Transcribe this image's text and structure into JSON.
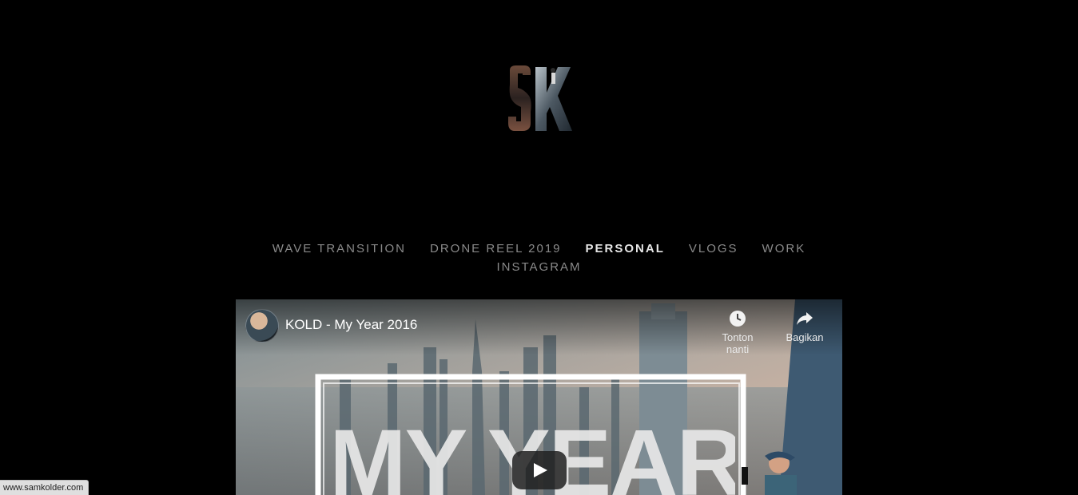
{
  "nav": {
    "row1": [
      "WAVE TRANSITION",
      "DRONE REEL 2019",
      "PERSONAL",
      "VLOGS",
      "WORK"
    ],
    "row2": [
      "INSTAGRAM"
    ],
    "active": "PERSONAL"
  },
  "video": {
    "title": "KOLD - My Year 2016",
    "watch_later_label": "Tonton nanti",
    "share_label": "Bagikan",
    "overlay_text": "MY YEAR"
  },
  "statusbar": {
    "url": "www.samkolder.com"
  },
  "colors": {
    "background": "#000000",
    "nav_text": "#8a8a8a",
    "nav_active": "#e6e6e6"
  }
}
